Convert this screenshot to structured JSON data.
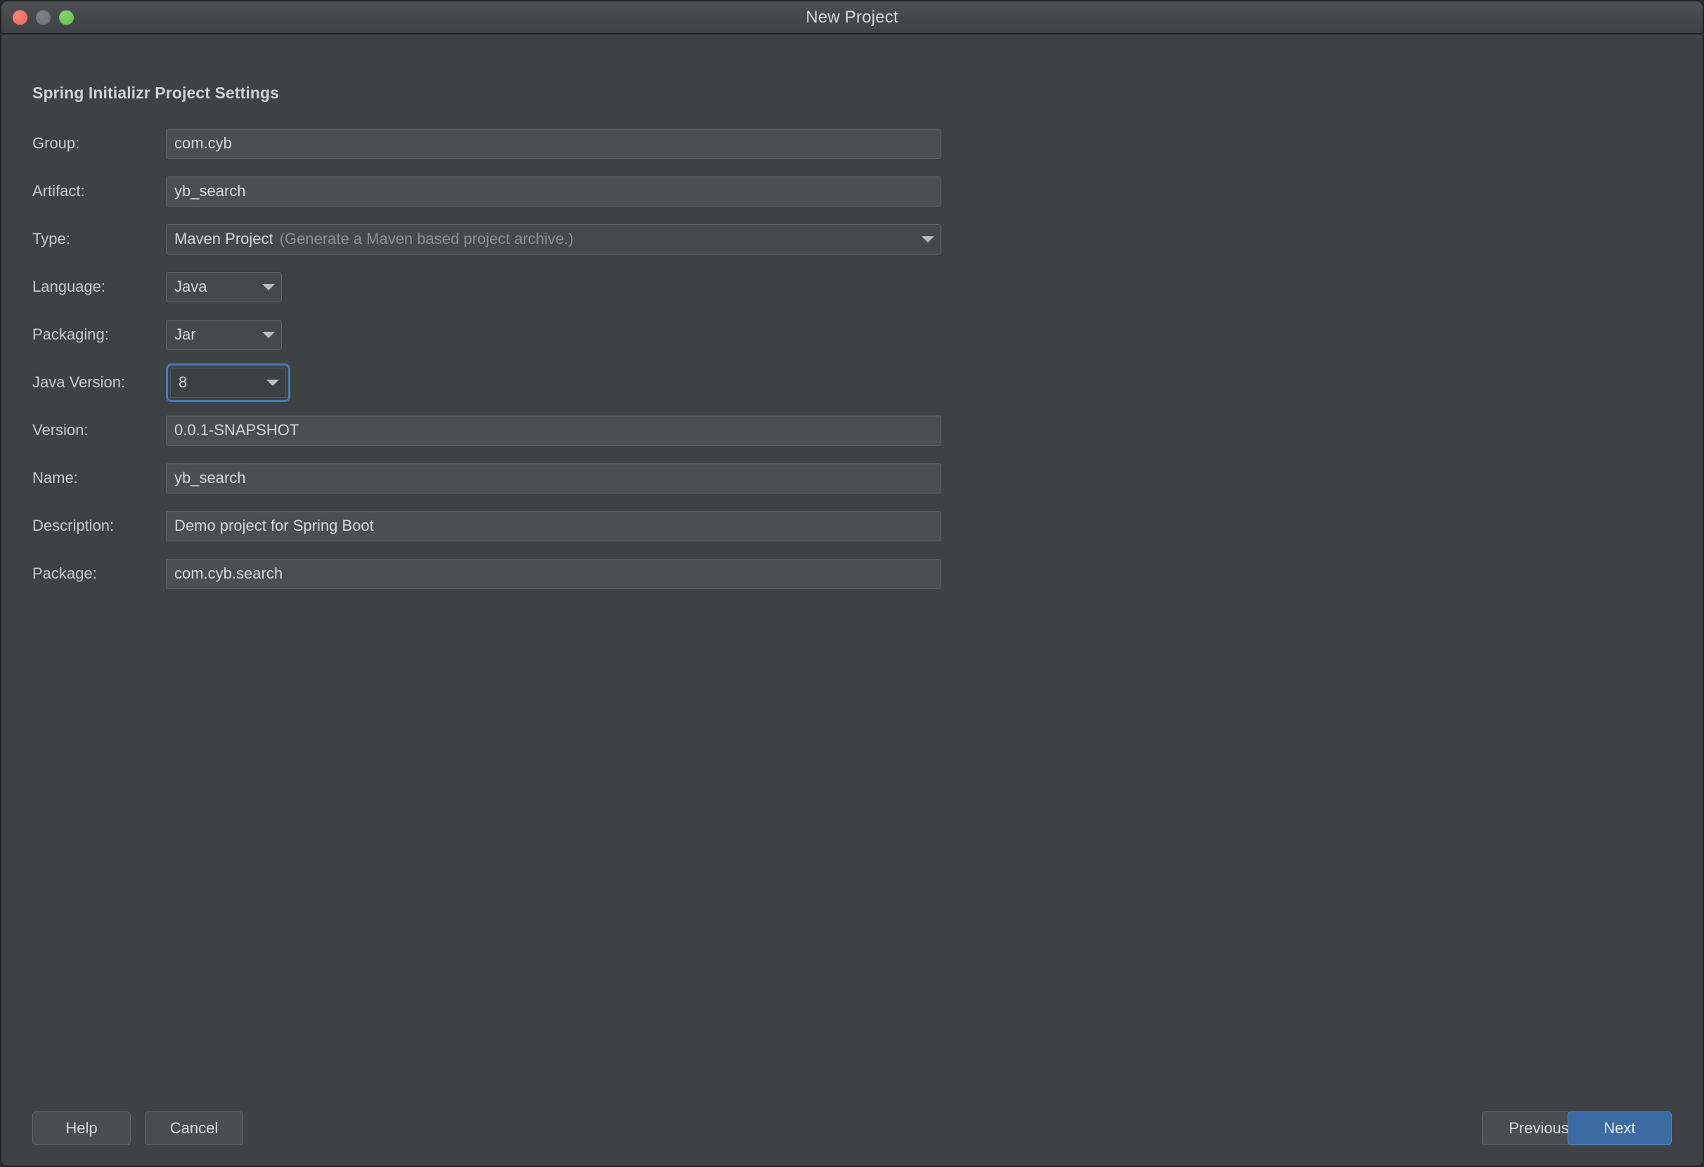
{
  "window": {
    "title": "New Project",
    "traffic_lights": [
      {
        "name": "close",
        "color": "#ec6a5e"
      },
      {
        "name": "minimize",
        "color": "#6c7073"
      },
      {
        "name": "maximize",
        "color": "#62c044"
      }
    ]
  },
  "heading": "Spring Initializr Project Settings",
  "fields": {
    "group": {
      "label": "Group:",
      "value": "com.cyb"
    },
    "artifact": {
      "label": "Artifact:",
      "value": "yb_search"
    },
    "type": {
      "label": "Type:",
      "value": "Maven Project",
      "hint": "(Generate a Maven based project archive.)"
    },
    "language": {
      "label": "Language:",
      "value": "Java"
    },
    "packaging": {
      "label": "Packaging:",
      "value": "Jar"
    },
    "java_version": {
      "label": "Java Version:",
      "value": "8"
    },
    "version": {
      "label": "Version:",
      "value": "0.0.1-SNAPSHOT"
    },
    "name": {
      "label": "Name:",
      "value": "yb_search"
    },
    "description": {
      "label": "Description:",
      "value": "Demo project for Spring Boot"
    },
    "package": {
      "label": "Package:",
      "value": "com.cyb.search"
    }
  },
  "footer": {
    "help": "Help",
    "cancel": "Cancel",
    "previous": "Previous",
    "next": "Next"
  },
  "colors": {
    "dialog_background": "#3e4245",
    "titlebar": "#46494c",
    "field_background": "#4b4f4f",
    "combo_background": "#45494b",
    "focus_ring": "#4a7ab8",
    "primary_button": "#3c6ba3",
    "text": "#d5d8da",
    "hint_text": "#8b9094"
  }
}
